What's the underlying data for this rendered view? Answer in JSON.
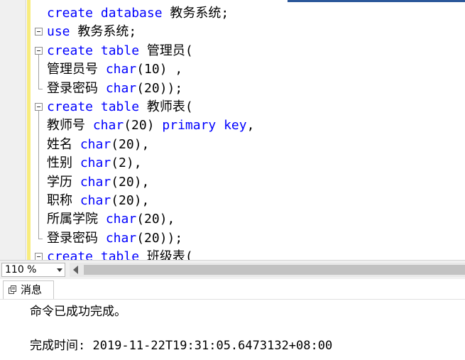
{
  "editor": {
    "lines": [
      {
        "fold": "none",
        "tokens": [
          {
            "kw": true,
            "text": "create database"
          },
          {
            "kw": false,
            "text": " 教务系统;"
          }
        ]
      },
      {
        "fold": "box",
        "tokens": [
          {
            "kw": true,
            "text": "use"
          },
          {
            "kw": false,
            "text": " 教务系统;"
          }
        ]
      },
      {
        "fold": "box",
        "tokens": [
          {
            "kw": true,
            "text": "create table"
          },
          {
            "kw": false,
            "text": " 管理员("
          }
        ]
      },
      {
        "fold": "line",
        "tokens": [
          {
            "kw": false,
            "text": "管理员号 "
          },
          {
            "kw": true,
            "text": "char"
          },
          {
            "kw": false,
            "text": "(10) ,"
          }
        ]
      },
      {
        "fold": "end",
        "tokens": [
          {
            "kw": false,
            "text": "登录密码 "
          },
          {
            "kw": true,
            "text": "char"
          },
          {
            "kw": false,
            "text": "(20));"
          }
        ]
      },
      {
        "fold": "box",
        "tokens": [
          {
            "kw": true,
            "text": "create table"
          },
          {
            "kw": false,
            "text": " 教师表("
          }
        ]
      },
      {
        "fold": "line",
        "tokens": [
          {
            "kw": false,
            "text": "教师号 "
          },
          {
            "kw": true,
            "text": "char"
          },
          {
            "kw": false,
            "text": "(20) "
          },
          {
            "kw": true,
            "text": "primary key"
          },
          {
            "kw": false,
            "text": ","
          }
        ]
      },
      {
        "fold": "line",
        "tokens": [
          {
            "kw": false,
            "text": "姓名 "
          },
          {
            "kw": true,
            "text": "char"
          },
          {
            "kw": false,
            "text": "(20),"
          }
        ]
      },
      {
        "fold": "line",
        "tokens": [
          {
            "kw": false,
            "text": "性别 "
          },
          {
            "kw": true,
            "text": "char"
          },
          {
            "kw": false,
            "text": "(2),"
          }
        ]
      },
      {
        "fold": "line",
        "tokens": [
          {
            "kw": false,
            "text": "学历 "
          },
          {
            "kw": true,
            "text": "char"
          },
          {
            "kw": false,
            "text": "(20),"
          }
        ]
      },
      {
        "fold": "line",
        "tokens": [
          {
            "kw": false,
            "text": "职称 "
          },
          {
            "kw": true,
            "text": "char"
          },
          {
            "kw": false,
            "text": "(20),"
          }
        ]
      },
      {
        "fold": "line",
        "tokens": [
          {
            "kw": false,
            "text": "所属学院 "
          },
          {
            "kw": true,
            "text": "char"
          },
          {
            "kw": false,
            "text": "(20),"
          }
        ]
      },
      {
        "fold": "end",
        "tokens": [
          {
            "kw": false,
            "text": "登录密码 "
          },
          {
            "kw": true,
            "text": "char"
          },
          {
            "kw": false,
            "text": "(20));"
          }
        ]
      },
      {
        "fold": "box",
        "tokens": [
          {
            "kw": true,
            "text": "create table"
          },
          {
            "kw": false,
            "text": " 班级表("
          }
        ]
      }
    ],
    "colors": {
      "keyword": "#0000ff",
      "text": "#000000",
      "change_bar": "#f8ec7e"
    }
  },
  "statusbar": {
    "zoom": "110 %"
  },
  "messages": {
    "tab_label": "消息",
    "line1": "命令已成功完成。",
    "line2": "完成时间: 2019-11-22T19:31:05.6473132+08:00"
  }
}
